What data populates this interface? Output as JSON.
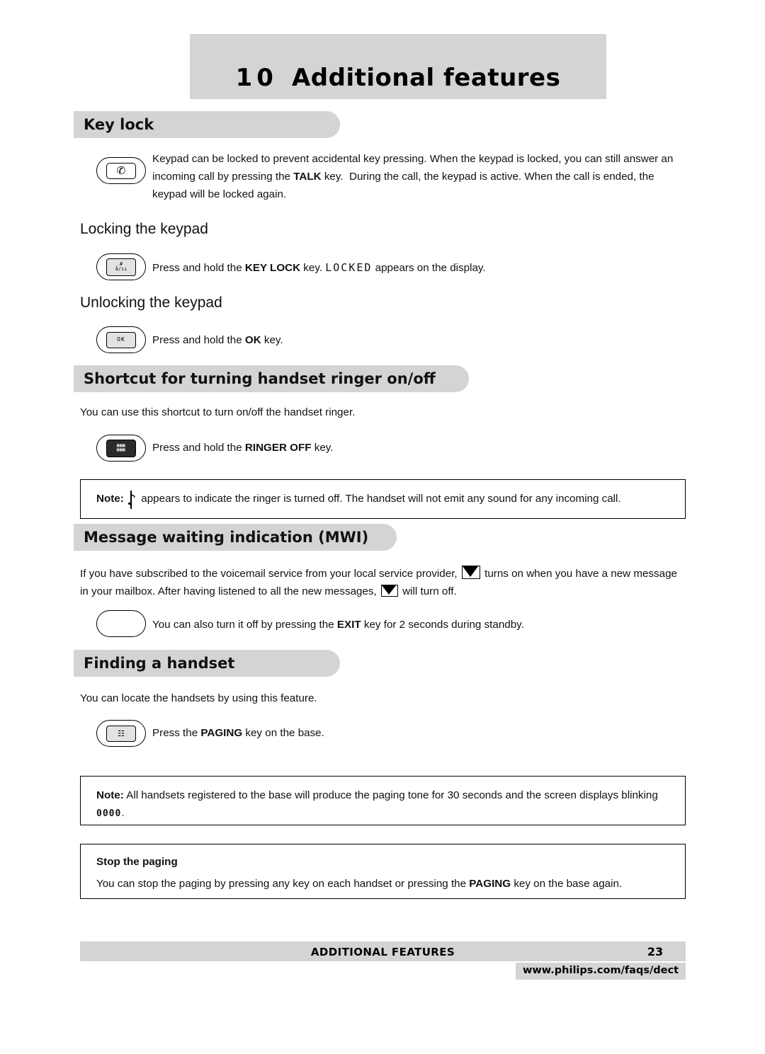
{
  "chapter": {
    "number": "10",
    "title": "Additional features"
  },
  "sections": {
    "key_lock": {
      "heading": "Key lock",
      "intro": "Keypad can be locked to prevent accidental key pressing. When the keypad is locked, you can still answer an incoming call by pressing the TALK key.  During the call, the keypad is active. When the call is ended, the keypad will be locked again.",
      "intro_bold": "TALK",
      "locking": {
        "subheading": "Locking the keypad",
        "text_before": "Press and hold the ",
        "key_bold": "KEY LOCK",
        "text_mid": " key. ",
        "lcd": "LOCKED",
        "text_after": " appears on the display."
      },
      "unlocking": {
        "subheading": "Unlocking the keypad",
        "text_before": "Press and hold the ",
        "key_bold": "OK",
        "text_after": " key."
      }
    },
    "ringer_shortcut": {
      "heading": "Shortcut for turning handset ringer on/off",
      "intro": "You can use this shortcut to turn on/off the handset ringer.",
      "step_before": "Press and hold the ",
      "step_bold": "RINGER OFF",
      "step_after": " key.",
      "note_label": "Note:",
      "note_text": "appears to indicate the ringer is turned off. The handset will not emit any sound for any incoming call."
    },
    "mwi": {
      "heading": "Message waiting indication (MWI)",
      "para_1a": "If you have subscribed to the voicemail service from your local service provider,",
      "para_1b": "turns on when you have a new message in your mailbox. After having listened to all the new messages,",
      "para_1c": "will turn off.",
      "step_before": "You can also turn it off by pressing the ",
      "step_bold": "EXIT",
      "step_after": " key for 2 seconds during standby."
    },
    "finding_handset": {
      "heading": "Finding a handset",
      "intro": "You can locate the handsets by using this feature.",
      "step_before": "Press the ",
      "step_bold": "PAGING",
      "step_after": " key on the base.",
      "note_label": "Note:",
      "note_text_a": "All handsets registered to the base will produce the paging tone for 30 seconds and the screen displays blinking",
      "note_lcd": "0000",
      "note_text_b": ".",
      "stop_heading": "Stop the paging",
      "stop_text_before": "You can stop the paging by pressing any key on each handset or pressing the ",
      "stop_bold": "PAGING",
      "stop_text_after": " key on the base again."
    }
  },
  "keys": {
    "talk_icon": "talk-handset-key",
    "keylock_label_top": "#",
    "keylock_label_bottom": "å/ıı",
    "ok_label": "OK",
    "ringer_icon": "ringer-keypad-grid",
    "paging_icon": "paging-base-key"
  },
  "footer": {
    "title": "ADDITIONAL FEATURES",
    "page": "23",
    "url": "www.philips.com/faqs/dect"
  }
}
